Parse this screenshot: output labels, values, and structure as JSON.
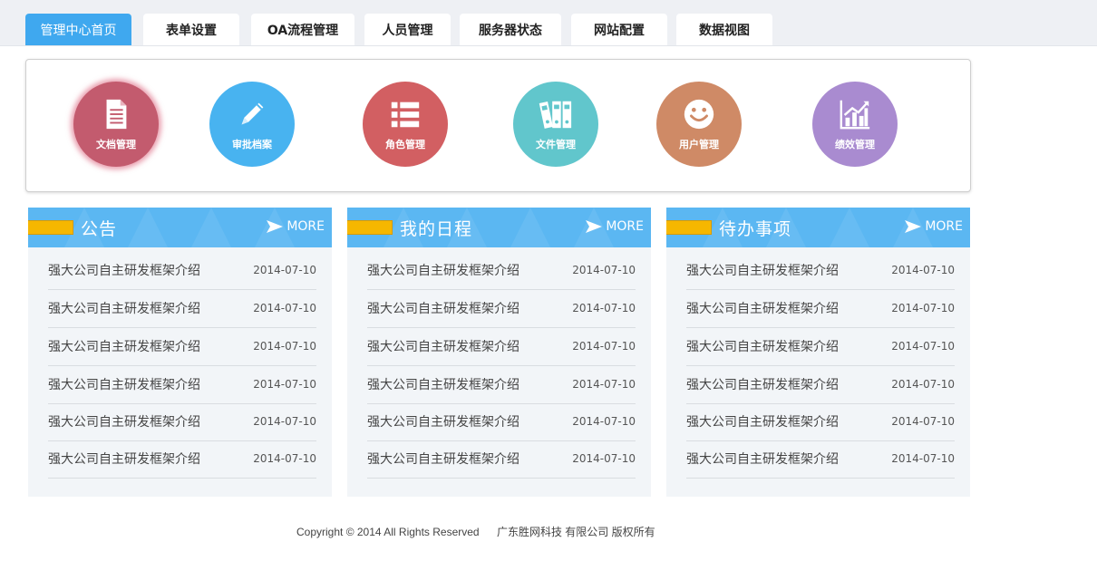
{
  "tabs": [
    {
      "label": "管理中心首页",
      "active": true
    },
    {
      "label": "表单设置"
    },
    {
      "label": "OA流程管理"
    },
    {
      "label": "人员管理"
    },
    {
      "label": "服务器状态"
    },
    {
      "label": "网站配置"
    },
    {
      "label": "数据视图"
    }
  ],
  "shortcuts": [
    {
      "label": "文档管理",
      "icon": "document-icon",
      "color": "#c35b6e"
    },
    {
      "label": "审批档案",
      "icon": "pencil-icon",
      "color": "#48b3f0"
    },
    {
      "label": "角色管理",
      "icon": "list-icon",
      "color": "#d25f62"
    },
    {
      "label": "文件管理",
      "icon": "binders-icon",
      "color": "#61c6cc"
    },
    {
      "label": "用户管理",
      "icon": "smiley-icon",
      "color": "#cf8a66"
    },
    {
      "label": "绩效管理",
      "icon": "chart-icon",
      "color": "#a98bd0"
    }
  ],
  "boxes": [
    {
      "title": "公告",
      "more": "MORE",
      "items": [
        {
          "title": "强大公司自主研发框架介绍",
          "date": "2014-07-10"
        },
        {
          "title": "强大公司自主研发框架介绍",
          "date": "2014-07-10"
        },
        {
          "title": "强大公司自主研发框架介绍",
          "date": "2014-07-10"
        },
        {
          "title": "强大公司自主研发框架介绍",
          "date": "2014-07-10"
        },
        {
          "title": "强大公司自主研发框架介绍",
          "date": "2014-07-10"
        },
        {
          "title": "强大公司自主研发框架介绍",
          "date": "2014-07-10"
        }
      ]
    },
    {
      "title": "我的日程",
      "more": "MORE",
      "items": [
        {
          "title": "强大公司自主研发框架介绍",
          "date": "2014-07-10"
        },
        {
          "title": "强大公司自主研发框架介绍",
          "date": "2014-07-10"
        },
        {
          "title": "强大公司自主研发框架介绍",
          "date": "2014-07-10"
        },
        {
          "title": "强大公司自主研发框架介绍",
          "date": "2014-07-10"
        },
        {
          "title": "强大公司自主研发框架介绍",
          "date": "2014-07-10"
        },
        {
          "title": "强大公司自主研发框架介绍",
          "date": "2014-07-10"
        }
      ]
    },
    {
      "title": "待办事项",
      "more": "MORE",
      "items": [
        {
          "title": "强大公司自主研发框架介绍",
          "date": "2014-07-10"
        },
        {
          "title": "强大公司自主研发框架介绍",
          "date": "2014-07-10"
        },
        {
          "title": "强大公司自主研发框架介绍",
          "date": "2014-07-10"
        },
        {
          "title": "强大公司自主研发框架介绍",
          "date": "2014-07-10"
        },
        {
          "title": "强大公司自主研发框架介绍",
          "date": "2014-07-10"
        },
        {
          "title": "强大公司自主研发框架介绍",
          "date": "2014-07-10"
        }
      ]
    }
  ],
  "footer": {
    "copyright": "Copyright © 2014 All Rights Reserved",
    "company": "广东胜网科技 有限公司 版权所有"
  },
  "colors": {
    "accent": "#3fa8ef",
    "box_header": "#5bb7f2",
    "stripe": "#f6b700"
  }
}
